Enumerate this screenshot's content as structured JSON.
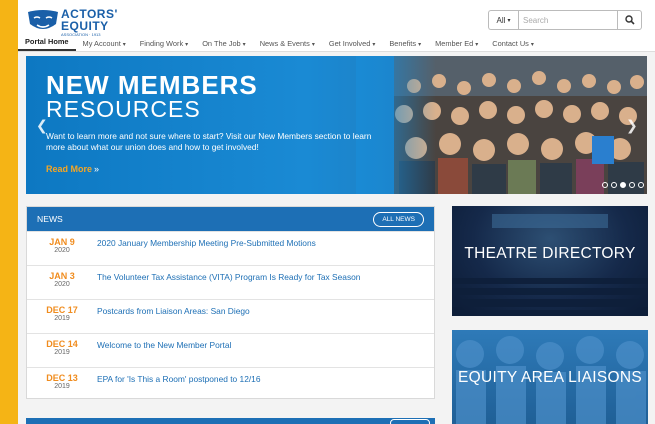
{
  "header": {
    "logo_line1": "ACTORS'",
    "logo_line2": "EQUITY",
    "logo_line3": "ASSOCIATION · 1913",
    "search_scope": "All",
    "search_placeholder": "Search"
  },
  "nav": [
    {
      "label": "Portal Home",
      "active": true
    },
    {
      "label": "My Account",
      "dropdown": true
    },
    {
      "label": "Finding Work",
      "dropdown": true
    },
    {
      "label": "On The Job",
      "dropdown": true
    },
    {
      "label": "News & Events",
      "dropdown": true
    },
    {
      "label": "Get Involved",
      "dropdown": true
    },
    {
      "label": "Benefits",
      "dropdown": true
    },
    {
      "label": "Member Ed",
      "dropdown": true
    },
    {
      "label": "Contact Us",
      "dropdown": true
    }
  ],
  "hero": {
    "title_line1": "NEW MEMBERS",
    "title_line2": "RESOURCES",
    "description": "Want to learn more and not sure where to start? Visit our New Members section to learn more about what our union does and how to get involved!",
    "read_more": "Read More",
    "slide_count": 5,
    "active_slide": 3
  },
  "news": {
    "title": "NEWS",
    "all_label": "ALL NEWS",
    "items": [
      {
        "month_day": "JAN 9",
        "year": "2020",
        "headline": "2020 January Membership Meeting Pre-Submitted Motions"
      },
      {
        "month_day": "JAN 3",
        "year": "2020",
        "headline": "The Volunteer Tax Assistance (VITA) Program Is Ready for Tax Season"
      },
      {
        "month_day": "DEC 17",
        "year": "2019",
        "headline": "Postcards from Liaison Areas: San Diego"
      },
      {
        "month_day": "DEC 14",
        "year": "2019",
        "headline": "Welcome to the New Member Portal"
      },
      {
        "month_day": "DEC 13",
        "year": "2019",
        "headline": "EPA for 'Is This a Room' postponed to 12/16"
      }
    ]
  },
  "tiles": {
    "theatre": "THEATRE DIRECTORY",
    "liaisons": "EQUITY AREA LIAISONS"
  },
  "colors": {
    "brand_blue": "#1d6fb5",
    "accent_orange": "#f08c1e",
    "page_border": "#f5b415"
  }
}
